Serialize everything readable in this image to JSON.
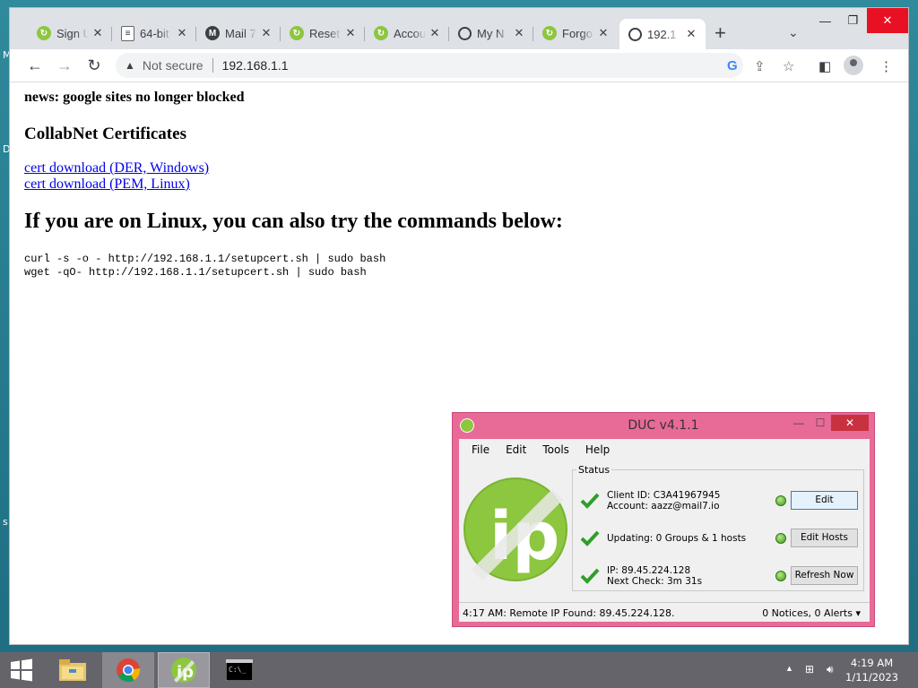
{
  "desktop": {
    "edge_letters": [
      "M",
      "D",
      "s"
    ]
  },
  "browser": {
    "tabs": [
      {
        "title": "Sign U",
        "icon": "green-ip-icon"
      },
      {
        "title": "64-bit",
        "icon": "document-icon"
      },
      {
        "title": "Mail 7",
        "icon": "mail-m-icon"
      },
      {
        "title": "Reset",
        "icon": "green-ip-icon"
      },
      {
        "title": "Accou",
        "icon": "green-ip-icon"
      },
      {
        "title": "My N",
        "icon": "globe-icon"
      },
      {
        "title": "Forgo",
        "icon": "green-ip-icon"
      },
      {
        "title": "192.1",
        "icon": "globe-icon",
        "active": true
      }
    ],
    "security_label": "Not secure",
    "url": "192.168.1.1"
  },
  "page": {
    "news": "news: google sites no longer blocked",
    "certs_heading": "CollabNet Certificates",
    "links": [
      "cert download (DER, Windows)",
      "cert download (PEM, Linux)"
    ],
    "linux_heading": "If you are on Linux, you can also try the commands below:",
    "commands": [
      "curl -s -o - http://192.168.1.1/setupcert.sh | sudo bash",
      "wget -qO- http://192.168.1.1/setupcert.sh | sudo bash"
    ]
  },
  "duc": {
    "title": "DUC v4.1.1",
    "menu": [
      "File",
      "Edit",
      "Tools",
      "Help"
    ],
    "status_label": "Status",
    "rows": [
      {
        "lines": [
          "Client ID: C3A41967945",
          "Account: aazz@mail7.io"
        ],
        "button": "Edit"
      },
      {
        "lines": [
          "Updating: 0 Groups & 1 hosts"
        ],
        "button": "Edit Hosts"
      },
      {
        "lines": [
          "IP: 89.45.224.128",
          "Next Check: 3m 31s"
        ],
        "button": "Refresh Now"
      }
    ],
    "statusbar_left": "4:17 AM: Remote IP Found: 89.45.224.128.",
    "statusbar_right": "0 Notices, 0 Alerts"
  },
  "taskbar": {
    "apps": [
      "file-explorer-icon",
      "chrome-icon",
      "duc-app-icon",
      "cmd-icon"
    ],
    "time": "4:19 AM",
    "date": "1/11/2023"
  },
  "colors": {
    "duc_frame": "#e86a97",
    "duc_green": "#8dc63f",
    "link": "#0000ee"
  }
}
